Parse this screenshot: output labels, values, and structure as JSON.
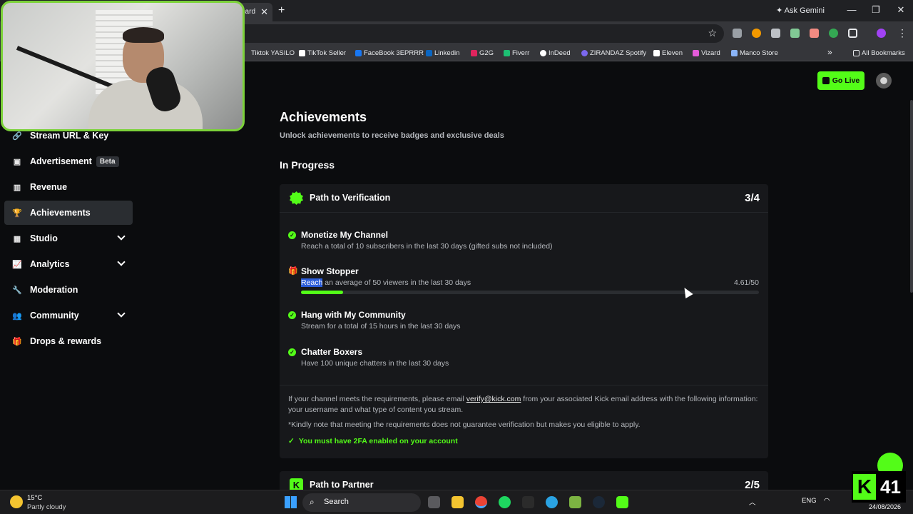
{
  "browser": {
    "tab_label": "oard",
    "tab_close": "✕",
    "new_tab": "+",
    "ask_gemini": "Ask Gemini",
    "window_buttons": [
      "—",
      "❐",
      "✕"
    ],
    "bookmarks": [
      {
        "label": "Tiktok YASILO",
        "color": "#35363a"
      },
      {
        "label": "TikTok Seller",
        "color": "#ffffff"
      },
      {
        "label": "FaceBook 3EPRRR",
        "color": "#1877f2"
      },
      {
        "label": "Linkedin",
        "color": "#0a66c2"
      },
      {
        "label": "G2G",
        "color": "#e0245e"
      },
      {
        "label": "Fiverr",
        "color": "#1dbf73"
      },
      {
        "label": "InDeed",
        "color": "#ffffff"
      },
      {
        "label": "ZIRANDAZ Spotify",
        "color": "#7b68ee"
      },
      {
        "label": "Eleven",
        "color": "#ffffff"
      },
      {
        "label": "Vizard",
        "color": "#e35bd9"
      },
      {
        "label": "Manco Store",
        "color": "#8ab4f8"
      }
    ],
    "more_bookmarks": "»",
    "all_bookmarks": "All Bookmarks"
  },
  "sidebar": {
    "items": [
      {
        "label": "Stream URL & Key",
        "icon": "🔗"
      },
      {
        "label": "Advertisement",
        "icon": "▣",
        "badge": "Beta"
      },
      {
        "label": "Revenue",
        "icon": "▥"
      },
      {
        "label": "Achievements",
        "icon": "🏆",
        "active": true
      },
      {
        "label": "Studio",
        "icon": "▦",
        "expandable": true
      },
      {
        "label": "Analytics",
        "icon": "📈",
        "expandable": true
      },
      {
        "label": "Moderation",
        "icon": "🔧"
      },
      {
        "label": "Community",
        "icon": "👥",
        "expandable": true
      },
      {
        "label": "Drops & rewards",
        "icon": "🎁"
      }
    ]
  },
  "header": {
    "go_live": "Go Live"
  },
  "main": {
    "title": "Achievements",
    "subtitle": "Unlock achievements to receive badges and exclusive deals",
    "section": "In Progress",
    "card": {
      "title": "Path to Verification",
      "count": "3/4",
      "tasks": [
        {
          "title": "Monetize My Channel",
          "desc": "Reach a total of 10 subscribers in the last 30 days (gifted subs not included)",
          "done": true
        },
        {
          "title": "Show Stopper",
          "desc_highlight": "Reach",
          "desc_rest": " an average of 50 viewers in the last 30 days",
          "value": "4.61/50",
          "progress": 0.092,
          "done": false
        },
        {
          "title": "Hang with My Community",
          "desc": "Stream for a total of 15 hours in the last 30 days",
          "done": true
        },
        {
          "title": "Chatter Boxers",
          "desc": "Have 100 unique chatters in the last 30 days",
          "done": true
        }
      ],
      "info_pre": "If your channel meets the requirements, please email ",
      "info_email": "verify@kick.com",
      "info_post": " from your associated Kick email address with the following information: your username and what type of content you stream.",
      "note": "*Kindly note that meeting the requirements does not guarantee verification but makes you eligible to apply.",
      "twofa": "You must have 2FA enabled on your account"
    },
    "card2": {
      "title": "Path to Partner",
      "count": "2/5"
    }
  },
  "taskbar": {
    "temp": "15°C",
    "weather": "Partly cloudy",
    "search": "Search",
    "lang": "ENG",
    "date": "24/08/2026"
  },
  "overlay": {
    "kick_logo": "K",
    "count": "41"
  },
  "colors": {
    "accent": "#53fc18",
    "background": "#0b0c0e",
    "card": "#17181b"
  }
}
